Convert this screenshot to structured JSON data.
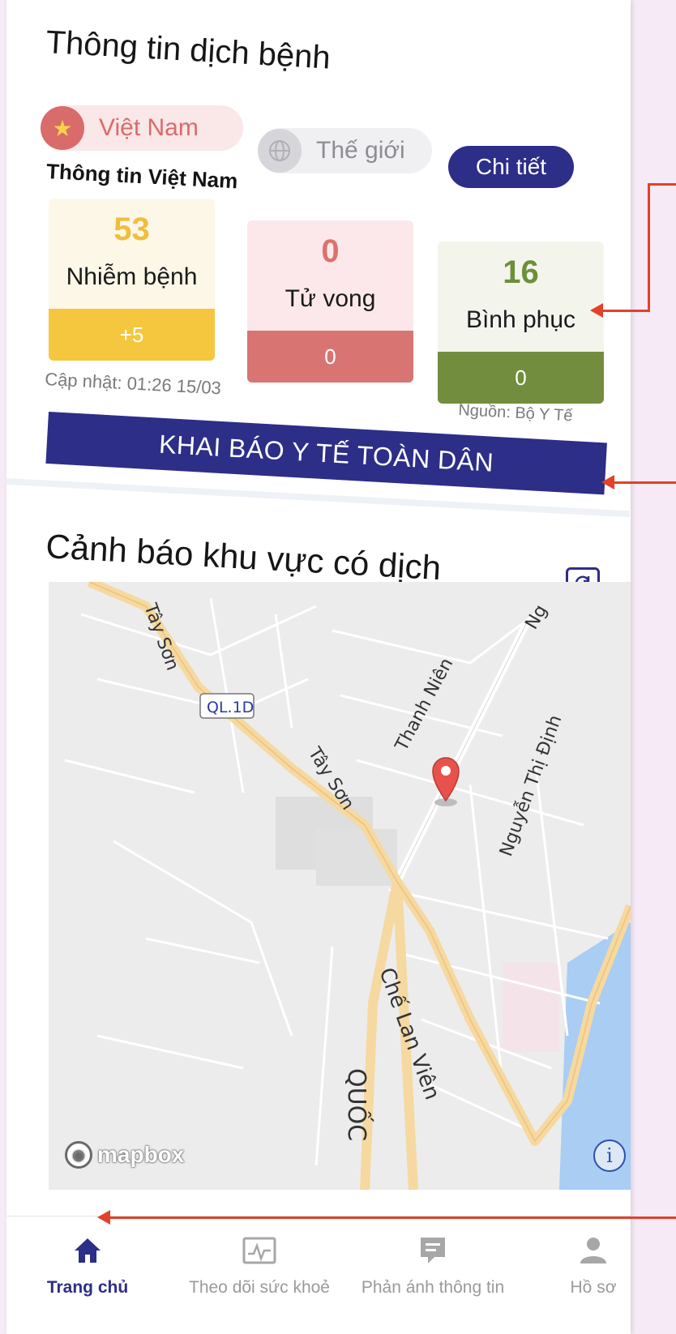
{
  "header": {
    "title": "Thông tin dịch bệnh"
  },
  "tabs": {
    "vietnam_label": "Việt Nam",
    "world_label": "Thế giới",
    "detail_label": "Chi tiết"
  },
  "section_subtitle": "Thông tin Việt Nam",
  "stats": [
    {
      "value": "53",
      "label": "Nhiễm bệnh",
      "delta": "+5",
      "color": "#f5c73f"
    },
    {
      "value": "0",
      "label": "Tử vong",
      "delta": "0",
      "color": "#d87573"
    },
    {
      "value": "16",
      "label": "Bình phục",
      "delta": "0",
      "color": "#728d3d"
    }
  ],
  "updated_text": "Cập nhật: 01:26 15/03",
  "source_text": "Nguồn: Bộ Y Tế",
  "declare_button": "KHAI BÁO Y TẾ TOÀN DÂN",
  "map_section": {
    "title": "Cảnh báo khu vực có dịch",
    "refresh_icon": "refresh-icon",
    "road_labels": [
      "Tây Sơn",
      "QL.1D",
      "Tây Sơn",
      "Thanh Niên",
      "Nguyễn Thị Định",
      "Chế Lan Viên",
      "QUỐC",
      "Ng"
    ],
    "attribution": "mapbox",
    "info_icon": "i"
  },
  "bottom_nav": [
    {
      "label": "Trang chủ",
      "icon": "home-icon",
      "active": true
    },
    {
      "label": "Theo dõi sức khoẻ",
      "icon": "health-monitor-icon",
      "active": false
    },
    {
      "label": "Phản ánh thông tin",
      "icon": "feedback-icon",
      "active": false
    },
    {
      "label": "Hồ sơ",
      "icon": "profile-icon",
      "active": false
    }
  ],
  "colors": {
    "primary": "#2d2e87",
    "accent_arrow": "#e2412a"
  }
}
